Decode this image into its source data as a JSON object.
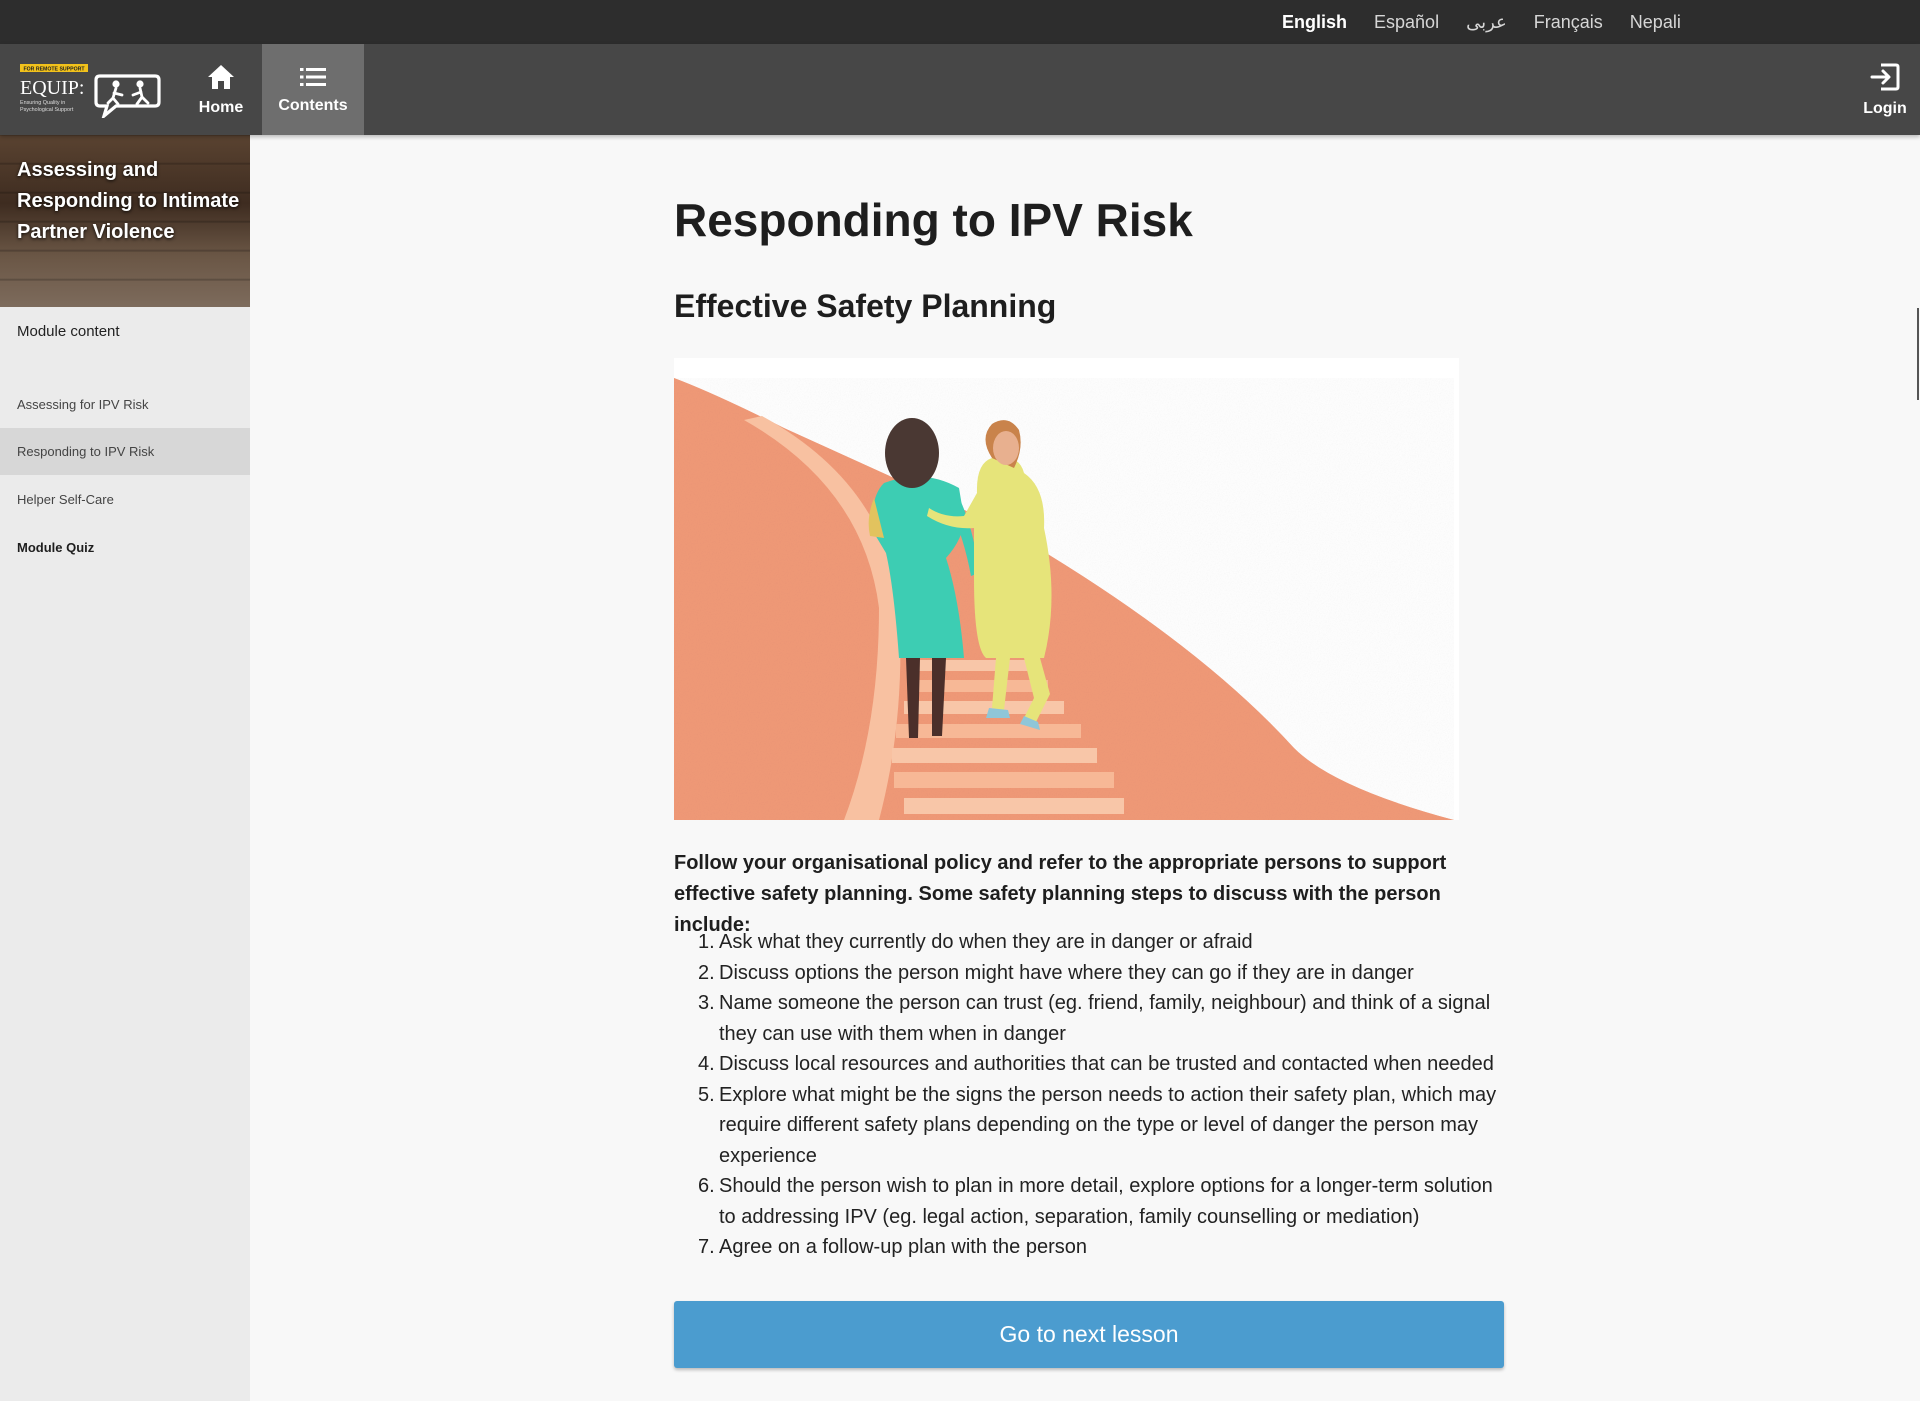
{
  "languages": [
    {
      "label": "English",
      "active": true
    },
    {
      "label": "Español",
      "active": false
    },
    {
      "label": "عربى",
      "active": false
    },
    {
      "label": "Français",
      "active": false
    },
    {
      "label": "Nepali",
      "active": false
    }
  ],
  "logo": {
    "tag": "FOR REMOTE SUPPORT",
    "name": "EQUIP:",
    "tagline_1": "Ensuring Quality in",
    "tagline_2": "Psychological Support"
  },
  "nav": {
    "home_label": "Home",
    "contents_label": "Contents",
    "login_label": "Login"
  },
  "sidebar": {
    "banner_title": "Assessing and Responding to Intimate Partner Violence",
    "heading": "Module content",
    "items": [
      {
        "label": "Assessing for IPV Risk"
      },
      {
        "label": "Responding to IPV Risk"
      },
      {
        "label": "Helper Self-Care"
      },
      {
        "label": "Module Quiz"
      }
    ]
  },
  "main": {
    "title": "Responding to IPV Risk",
    "section_title": "Effective Safety Planning",
    "intro": "Follow your organisational policy and refer to the appropriate persons to support effective safety planning.  Some safety planning steps to discuss with the person include:",
    "steps": [
      "Ask what they currently do when they are in danger or afraid",
      "Discuss options the person might have where they can go if they are in danger",
      "Name someone the person can trust (eg. friend, family, neighbour) and think of a signal they can use with them when in danger",
      "Discuss local resources and authorities that can be trusted and contacted when needed",
      "Explore what might be the signs the person needs to action their safety plan, which may require different safety plans depending on the type or level of danger the person may experience",
      "Should the person wish to plan in more detail, explore options for a longer-term solution to addressing IPV (eg. legal action, separation, family counselling or mediation)",
      "Agree on a follow-up plan with the person"
    ],
    "next_button": "Go to next lesson"
  },
  "colors": {
    "top_bar": "#2d2d2d",
    "nav_bar": "#474747",
    "nav_active": "#6e6e6e",
    "sidebar": "#ebebeb",
    "sidebar_active": "#d7d7d7",
    "button": "#4b9ccf",
    "illustration_hill": "#f19a78"
  }
}
